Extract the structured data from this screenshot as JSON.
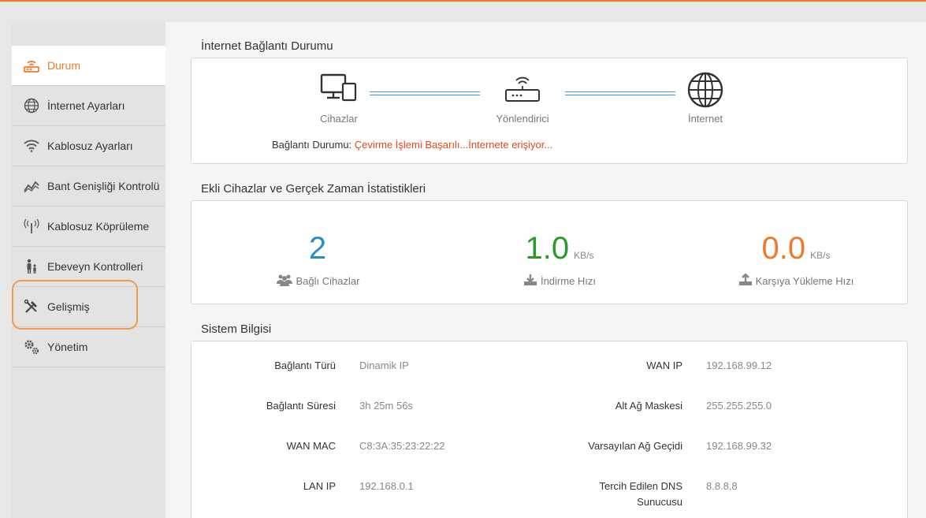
{
  "sidebar": {
    "items": [
      {
        "label": "Durum",
        "icon": "router-status-icon",
        "active": true
      },
      {
        "label": "İnternet Ayarları",
        "icon": "globe-icon"
      },
      {
        "label": "Kablosuz Ayarları",
        "icon": "wifi-icon"
      },
      {
        "label": "Bant Genişliği Kontrolü",
        "icon": "bandwidth-chart-icon"
      },
      {
        "label": "Kablosuz Köprüleme",
        "icon": "antenna-icon"
      },
      {
        "label": "Ebeveyn Kontrolleri",
        "icon": "parent-child-icon"
      },
      {
        "label": "Gelişmiş",
        "icon": "tools-icon"
      },
      {
        "label": "Yönetim",
        "icon": "gears-icon"
      }
    ]
  },
  "connection": {
    "title": "İnternet Bağlantı Durumu",
    "nodes": {
      "devices": "Cihazlar",
      "router": "Yönlendirici",
      "internet": "İnternet"
    },
    "status_label": "Bağlantı Durumu:",
    "status_value": "Çevirme İşlemi Başarılı...İnternete erişiyor..."
  },
  "stats": {
    "title": "Ekli Cihazlar ve Gerçek Zaman İstatistikleri",
    "devices": {
      "value": "2",
      "caption": "Bağlı Cihazlar"
    },
    "download": {
      "value": "1.0",
      "unit": "KB/s",
      "caption": "İndirme Hızı"
    },
    "upload": {
      "value": "0.0",
      "unit": "KB/s",
      "caption": "Karşıya Yükleme Hızı"
    },
    "colors": {
      "devices": "#2a8fc9",
      "download": "#2a9a2a",
      "upload": "#f07a2a"
    }
  },
  "system": {
    "title": "Sistem Bilgisi",
    "left": [
      {
        "label": "Bağlantı Türü",
        "value": "Dinamik IP"
      },
      {
        "label": "Bağlantı Süresi",
        "value": "3h 25m 56s"
      },
      {
        "label": "WAN MAC",
        "value": "C8:3A:35:23:22:22"
      },
      {
        "label": "LAN IP",
        "value": "192.168.0.1"
      }
    ],
    "right": [
      {
        "label": "WAN IP",
        "value": "192.168.99.12"
      },
      {
        "label": "Alt Ağ Maskesi",
        "value": "255.255.255.0"
      },
      {
        "label": "Varsayılan Ağ Geçidi",
        "value": "192.168.99.32"
      },
      {
        "label_line1": "Tercih Edilen DNS",
        "label_line2": "Sunucusu",
        "value": "8.8.8.8"
      }
    ]
  }
}
